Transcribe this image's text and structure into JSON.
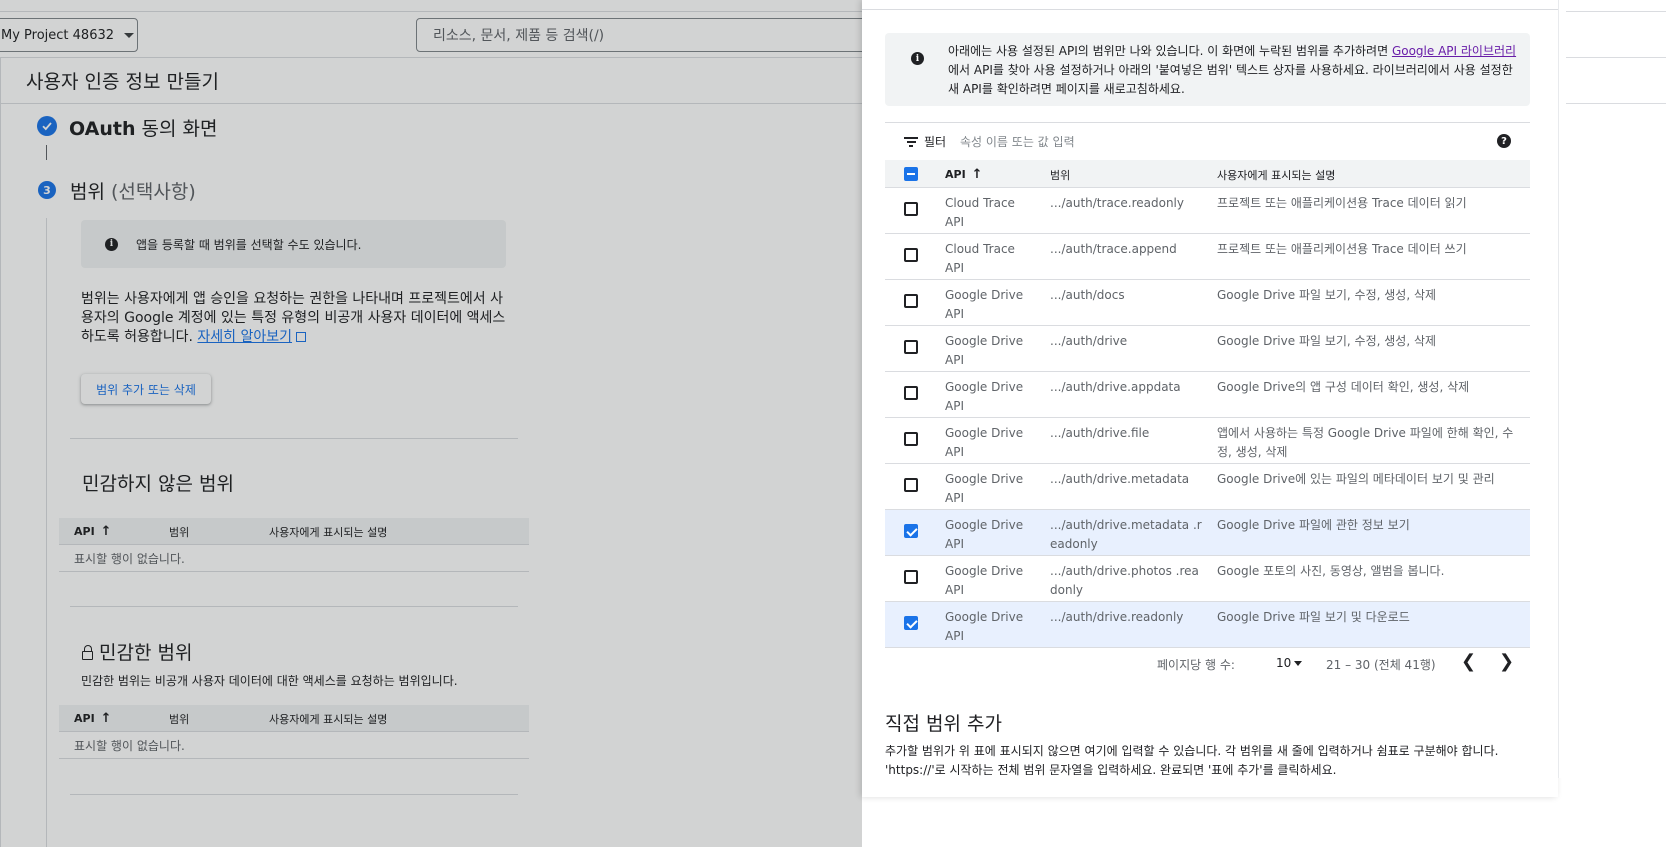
{
  "topbar": {
    "project_name": "My Project 48632",
    "search_placeholder": "리소스, 문서, 제품 등 검색(/)"
  },
  "page": {
    "title": "사용자 인증 정보 만들기"
  },
  "steps": {
    "step1_bold": "OAuth",
    "step1_rest": " 동의 화면",
    "step2_number": "3",
    "step2_label": "범위",
    "step2_optional": " (선택사항)"
  },
  "scopes_section": {
    "info_text": "앱을 등록할 때 범위를 선택할 수도 있습니다.",
    "description": "범위는 사용자에게 앱 승인을 요청하는 권한을 나타내며 프로젝트에서 사용자의 Google 계정에 있는 특정 유형의 비공개 사용자 데이터에 액세스하도록 허용합니다.",
    "learn_more": "자세히 알아보기",
    "add_button": "범위 추가 또는 삭제",
    "nonsensitive_title": "민감하지 않은 범위",
    "sensitive_title": "민감한 범위",
    "sensitive_desc": "민감한 범위는 비공개 사용자 데이터에 대한 액세스를 요청하는 범위입니다.",
    "col_api": "API",
    "col_scope": "범위",
    "col_desc": "사용자에게 표시되는 설명",
    "empty_row": "표시할 행이 없습니다."
  },
  "panel": {
    "info_text_before": "아래에는 사용 설정된 API의 범위만 나와 있습니다. 이 화면에 누락된 범위를 추가하려면 ",
    "info_link": "Google API 라이브러리",
    "info_text_after": "에서 API를 찾아 사용 설정하거나 아래의 '붙여넣은 범위' 텍스트 상자를 사용하세요. 라이브러리에서 사용 설정한 새 API를 확인하려면 페이지를 새로고침하세요.",
    "filter_label": "필터",
    "filter_placeholder": "속성 이름 또는 값 입력",
    "help": "?",
    "col_api": "API",
    "col_scope": "범위",
    "col_desc": "사용자에게 표시되는 설명",
    "rows": [
      {
        "api": "Cloud Trace API",
        "scope": ".../auth/trace.readonly",
        "desc": "프로젝트 또는 애플리케이션용 Trace 데이터 읽기",
        "checked": false
      },
      {
        "api": "Cloud Trace API",
        "scope": ".../auth/trace.append",
        "desc": "프로젝트 또는 애플리케이션용 Trace 데이터 쓰기",
        "checked": false
      },
      {
        "api": "Google Drive API",
        "scope": ".../auth/docs",
        "desc": "Google Drive 파일 보기, 수정, 생성, 삭제",
        "checked": false
      },
      {
        "api": "Google Drive API",
        "scope": ".../auth/drive",
        "desc": "Google Drive 파일 보기, 수정, 생성, 삭제",
        "checked": false
      },
      {
        "api": "Google Drive API",
        "scope": ".../auth/drive.appdata",
        "desc": "Google Drive의 앱 구성 데이터 확인, 생성, 삭제",
        "checked": false
      },
      {
        "api": "Google Drive API",
        "scope": ".../auth/drive.file",
        "desc": "앱에서 사용하는 특정 Google Drive 파일에 한해 확인, 수정, 생성, 삭제",
        "checked": false
      },
      {
        "api": "Google Drive API",
        "scope": ".../auth/drive.metadata",
        "desc": "Google Drive에 있는 파일의 메타데이터 보기 및 관리",
        "checked": false
      },
      {
        "api": "Google Drive API",
        "scope": ".../auth/drive.metadata .readonly",
        "desc": "Google Drive 파일에 관한 정보 보기",
        "checked": true
      },
      {
        "api": "Google Drive API",
        "scope": ".../auth/drive.photos .readonly",
        "desc": "Google 포토의 사진, 동영상, 앨범을 봅니다.",
        "checked": false
      },
      {
        "api": "Google Drive API",
        "scope": ".../auth/drive.readonly",
        "desc": "Google Drive 파일 보기 및 다운로드",
        "checked": true
      }
    ],
    "pager": {
      "rows_label": "페이지당 행 수:",
      "rows_value": "10",
      "range": "21 – 30 (전체 41행)"
    },
    "manual_title": "직접 범위 추가",
    "manual_desc": "추가할 범위가 위 표에 표시되지 않으면 여기에 입력할 수 있습니다. 각 범위를 새 줄에 입력하거나 쉼표로 구분해야 합니다. 'https://'로 시작하는 전체 범위 문자열을 입력하세요. 완료되면 '표에 추가'를 클릭하세요."
  }
}
